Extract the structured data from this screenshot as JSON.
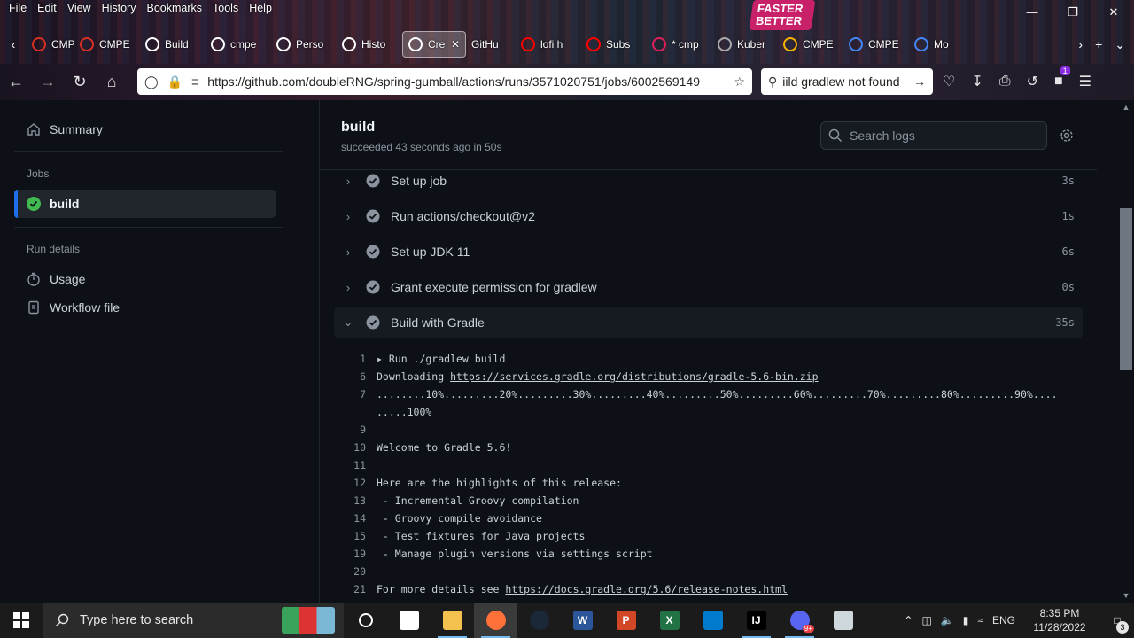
{
  "browser": {
    "menu": [
      "File",
      "Edit",
      "View",
      "History",
      "Bookmarks",
      "Tools",
      "Help"
    ],
    "hero_badge": "FASTER BETTER",
    "tabs": [
      {
        "label": "CMPE",
        "icon": "red-ring-icon",
        "color": "#d93025"
      },
      {
        "label": "CMPE",
        "icon": "red-ring-icon",
        "color": "#d93025"
      },
      {
        "label": "Build",
        "icon": "github-icon",
        "color": "#ffffff"
      },
      {
        "label": "cmpe",
        "icon": "github-icon",
        "color": "#ffffff"
      },
      {
        "label": "Perso",
        "icon": "github-icon",
        "color": "#ffffff"
      },
      {
        "label": "Histo",
        "icon": "github-icon",
        "color": "#ffffff"
      },
      {
        "label": "Cre",
        "icon": "github-icon",
        "color": "#ffffff",
        "active": true
      },
      {
        "label": "GitHu",
        "icon": "none",
        "color": "#ffffff"
      },
      {
        "label": "lofi h",
        "icon": "youtube-icon",
        "color": "#ff0000"
      },
      {
        "label": "Subs",
        "icon": "youtube-icon",
        "color": "#ff0000"
      },
      {
        "label": "* cmp",
        "icon": "slack-icon",
        "color": "#e01e5a"
      },
      {
        "label": "Kuber",
        "icon": "gear-icon",
        "color": "#aaaaaa"
      },
      {
        "label": "CMPE",
        "icon": "drive-icon",
        "color": "#f4b400"
      },
      {
        "label": "CMPE",
        "icon": "docs-icon",
        "color": "#4285f4"
      },
      {
        "label": "Mo",
        "icon": "docs-icon",
        "color": "#4285f4"
      }
    ],
    "url": "https://github.com/doubleRNG/spring-gumball/actions/runs/3571020751/jobs/6002569149",
    "search_value": "iild gradlew not found",
    "extension_badge": "1"
  },
  "sidebar": {
    "summary_label": "Summary",
    "jobs_heading": "Jobs",
    "job_item": "build",
    "run_details_heading": "Run details",
    "usage_label": "Usage",
    "workflow_file_label": "Workflow file"
  },
  "job": {
    "title": "build",
    "subtitle": "succeeded 43 seconds ago in 50s",
    "search_placeholder": "Search logs"
  },
  "steps": [
    {
      "name": "Set up job",
      "duration": "3s"
    },
    {
      "name": "Run actions/checkout@v2",
      "duration": "1s"
    },
    {
      "name": "Set up JDK 11",
      "duration": "6s"
    },
    {
      "name": "Grant execute permission for gradlew",
      "duration": "0s"
    },
    {
      "name": "Build with Gradle",
      "duration": "35s"
    }
  ],
  "log_lines": [
    {
      "num": "1",
      "text": "▸ Run ./gradlew build"
    },
    {
      "num": "6",
      "text": "Downloading ",
      "link": "https://services.gradle.org/distributions/gradle-5.6-bin.zip"
    },
    {
      "num": "7",
      "text": "........10%.........20%.........30%.........40%.........50%.........60%.........70%.........80%.........90%...."
    },
    {
      "num": "",
      "text": ".....100%"
    },
    {
      "num": "9",
      "text": ""
    },
    {
      "num": "10",
      "text": "Welcome to Gradle 5.6!"
    },
    {
      "num": "11",
      "text": ""
    },
    {
      "num": "12",
      "text": "Here are the highlights of this release:"
    },
    {
      "num": "13",
      "text": " - Incremental Groovy compilation"
    },
    {
      "num": "14",
      "text": " - Groovy compile avoidance"
    },
    {
      "num": "15",
      "text": " - Test fixtures for Java projects"
    },
    {
      "num": "19",
      "text": " - Manage plugin versions via settings script"
    },
    {
      "num": "20",
      "text": ""
    },
    {
      "num": "21",
      "text": "For more details see ",
      "link": "https://docs.gradle.org/5.6/release-notes.html"
    }
  ],
  "taskbar": {
    "search_placeholder": "Type here to search",
    "apps": [
      {
        "name": "task-view-icon",
        "label": "",
        "color": "#ffffff"
      },
      {
        "name": "file-explorer-icon",
        "label": "",
        "color": "#f2c14e"
      },
      {
        "name": "firefox-icon",
        "label": "",
        "color": "#ff7139",
        "active": true
      },
      {
        "name": "steam-icon",
        "label": "",
        "color": "#1b2838"
      },
      {
        "name": "word-icon",
        "label": "W",
        "color": "#2b579a"
      },
      {
        "name": "powerpoint-icon",
        "label": "P",
        "color": "#d24726"
      },
      {
        "name": "excel-icon",
        "label": "X",
        "color": "#217346"
      },
      {
        "name": "vscode-icon",
        "label": "",
        "color": "#007acc"
      },
      {
        "name": "intellij-icon",
        "label": "IJ",
        "color": "#000000"
      },
      {
        "name": "discord-icon",
        "label": "",
        "color": "#5865f2"
      },
      {
        "name": "paint-icon",
        "label": "",
        "color": "#cfd8dc"
      }
    ],
    "language": "ENG",
    "time": "8:35 PM",
    "date": "11/28/2022",
    "notification_count": "3",
    "discord_badge": "9+"
  }
}
